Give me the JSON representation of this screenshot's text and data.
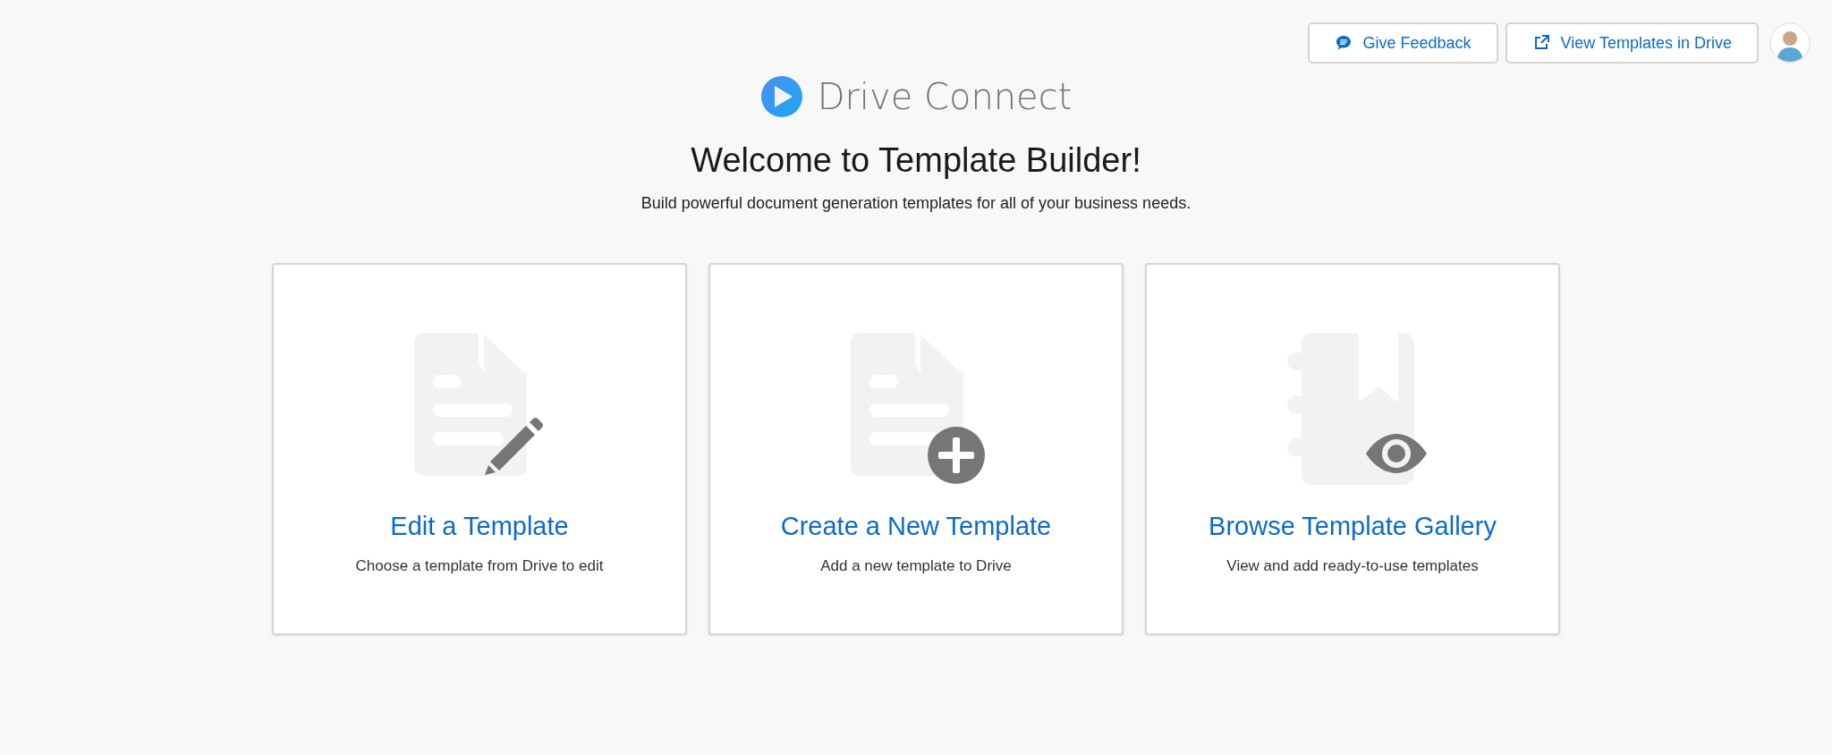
{
  "header": {
    "buttons": [
      {
        "kind": "feedback",
        "label": "Give Feedback"
      },
      {
        "kind": "external",
        "label": "View Templates in Drive"
      }
    ]
  },
  "logo": {
    "name": "Drive Connect"
  },
  "welcome": {
    "title": "Welcome to Template Builder!",
    "subtitle": "Build powerful document generation templates for all of your business needs."
  },
  "cards": [
    {
      "kind": "edit",
      "title": "Edit a Template",
      "description": "Choose a template from Drive to edit"
    },
    {
      "kind": "create",
      "title": "Create a New Template",
      "description": "Add a new template to Drive"
    },
    {
      "kind": "browse",
      "title": "Browse Template Gallery",
      "description": "View and add ready-to-use templates"
    }
  ]
}
